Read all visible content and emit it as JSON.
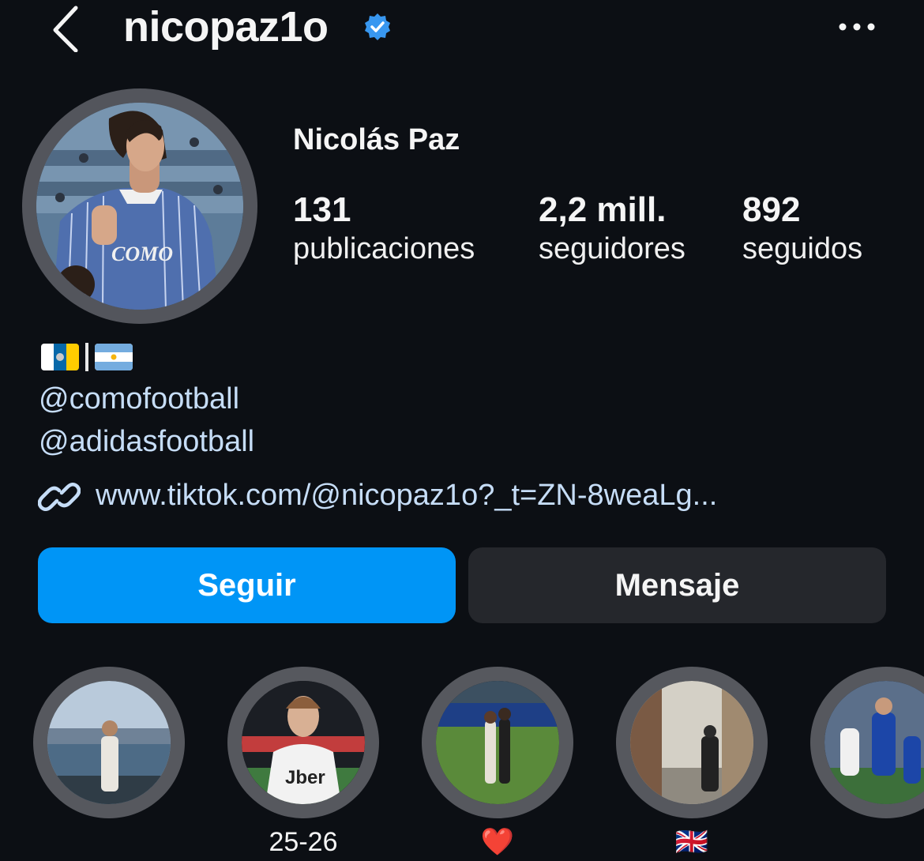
{
  "header": {
    "username": "nicopaz1o",
    "back_icon": "chevron-left-icon",
    "verified_icon": "verified-badge-icon",
    "more_icon": "more-horizontal-icon"
  },
  "profile": {
    "full_name": "Nicolás Paz",
    "stats": [
      {
        "value": "131",
        "label": "publicaciones"
      },
      {
        "value": "2,2 mill.",
        "label": "seguidores"
      },
      {
        "value": "892",
        "label": "seguidos"
      }
    ]
  },
  "bio": {
    "flags": [
      "canary-islands-flag",
      "argentina-flag"
    ],
    "separator": "|",
    "mentions": [
      "@comofootball",
      "@adidasfootball"
    ],
    "link": "www.tiktok.com/@nicopaz1o?_t=ZN-8weaLg..."
  },
  "actions": {
    "follow_label": "Seguir",
    "message_label": "Mensaje"
  },
  "highlights": [
    {
      "label": ""
    },
    {
      "label": "25-26"
    },
    {
      "label": "❤️"
    },
    {
      "label": "🇬🇧"
    },
    {
      "label": ""
    }
  ],
  "colors": {
    "background": "#0c0f14",
    "accent": "#0095f6",
    "link": "#c6ddf7",
    "secondary_button": "#25272c",
    "verified": "#3897f0"
  }
}
